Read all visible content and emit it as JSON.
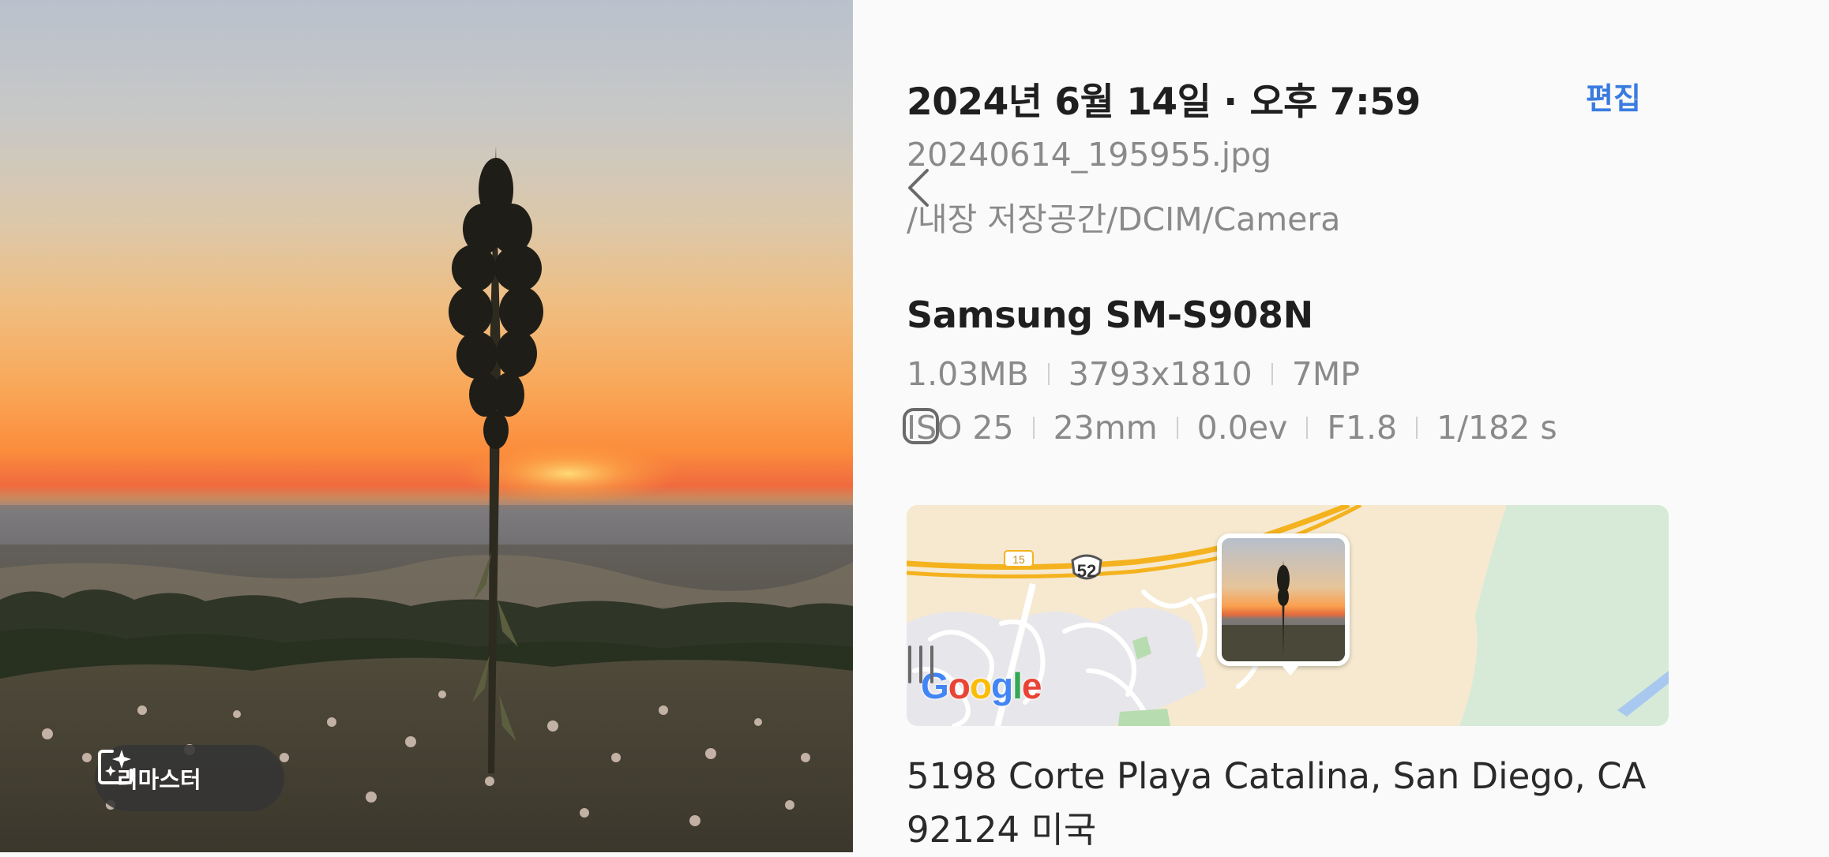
{
  "photo": {
    "remaster_label": "리마스터",
    "remaster_icon": "sparkle-frame-icon"
  },
  "details": {
    "date_title": "2024년 6월 14일 · 오후 7:59",
    "edit_label": "편집",
    "file_name": "20240614_195955.jpg",
    "file_path": "/내장 저장공간/DCIM/Camera",
    "device_model": "Samsung SM-S908N",
    "file_size": "1.03MB",
    "resolution": "3793x1810",
    "megapixels": "7MP",
    "iso": "ISO 25",
    "focal_length": "23mm",
    "exposure": "0.0ev",
    "aperture": "F1.8",
    "shutter": "1/182 s",
    "address_line1": "5198 Corte Playa Catalina, San Diego, CA",
    "address_line2": "92124 미국"
  },
  "map": {
    "route_number": "52",
    "route_number_2": "15",
    "google_letters": [
      "G",
      "o",
      "o",
      "g",
      "l",
      "e"
    ],
    "google_colors": [
      "#4285F4",
      "#EA4335",
      "#FBBC05",
      "#4285F4",
      "#34A853",
      "#EA4335"
    ]
  },
  "nav": {
    "back_icon": "chevron-left-icon",
    "home_icon": "rounded-square-icon",
    "recents_icon": "three-lines-icon"
  },
  "colors": {
    "accent": "#3a7be0"
  }
}
